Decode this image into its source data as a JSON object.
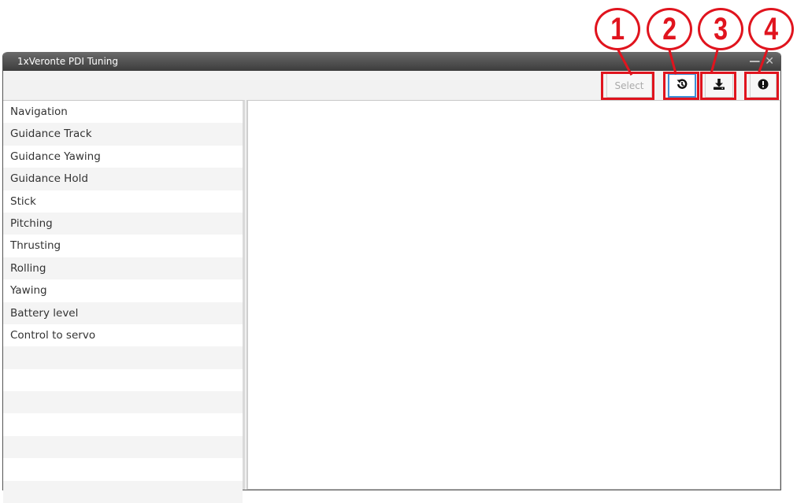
{
  "window": {
    "title": "1xVeronte PDI Tuning",
    "minimize_glyph": "—",
    "close_glyph": "✕"
  },
  "toolbar": {
    "select_label": "Select",
    "reload_icon": "history-icon",
    "download_icon": "download-icon",
    "info_icon": "exclamation-circle-icon"
  },
  "callouts": [
    "1",
    "2",
    "3",
    "4"
  ],
  "sidebar": {
    "items": [
      {
        "label": "Navigation"
      },
      {
        "label": "Guidance Track"
      },
      {
        "label": "Guidance Yawing"
      },
      {
        "label": "Guidance Hold"
      },
      {
        "label": "Stick"
      },
      {
        "label": "Pitching"
      },
      {
        "label": "Thrusting"
      },
      {
        "label": "Rolling"
      },
      {
        "label": "Yawing"
      },
      {
        "label": "Battery level"
      },
      {
        "label": "Control to servo"
      },
      {
        "label": ""
      },
      {
        "label": ""
      },
      {
        "label": ""
      },
      {
        "label": ""
      },
      {
        "label": ""
      },
      {
        "label": ""
      },
      {
        "label": ""
      }
    ]
  },
  "colors": {
    "annotation": "#e0141e",
    "titlebar": "#4a4a4a",
    "active_button_border": "#3d8fd6"
  }
}
